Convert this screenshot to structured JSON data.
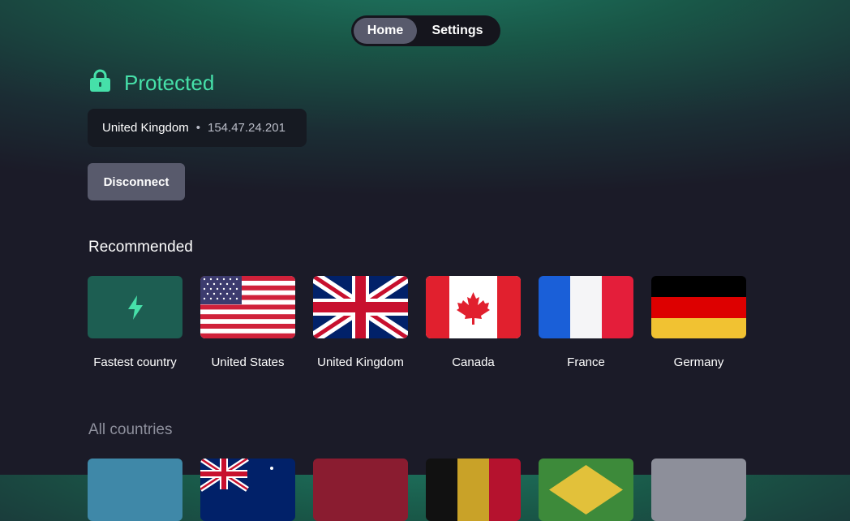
{
  "nav": {
    "tabs": [
      {
        "label": "Home",
        "active": true
      },
      {
        "label": "Settings",
        "active": false
      }
    ]
  },
  "status": {
    "text": "Protected",
    "icon": "lock-icon",
    "color": "#46e0a9"
  },
  "connection": {
    "country": "United Kingdom",
    "separator": "•",
    "ip": "154.47.24.201"
  },
  "disconnect_label": "Disconnect",
  "recommended": {
    "title": "Recommended",
    "items": [
      {
        "label": "Fastest country",
        "icon": "lightning-icon"
      },
      {
        "label": "United States",
        "icon": "us-flag-icon"
      },
      {
        "label": "United Kingdom",
        "icon": "uk-flag-icon"
      },
      {
        "label": "Canada",
        "icon": "canada-flag-icon"
      },
      {
        "label": "France",
        "icon": "france-flag-icon"
      },
      {
        "label": "Germany",
        "icon": "germany-flag-icon"
      }
    ]
  },
  "all_countries": {
    "title": "All countries"
  },
  "colors": {
    "accent": "#46e0a9",
    "background": "#1b1b28",
    "button": "#585a6c"
  }
}
